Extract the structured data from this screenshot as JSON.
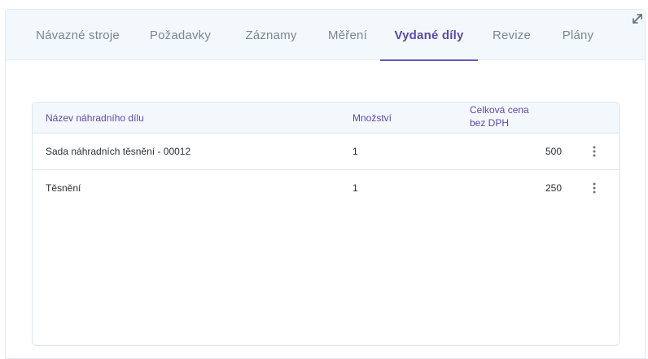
{
  "tabs": [
    {
      "label": "Návazné stroje",
      "active": false
    },
    {
      "label": "Požadavky",
      "active": false
    },
    {
      "label": "Záznamy",
      "active": false
    },
    {
      "label": "Měření",
      "active": false
    },
    {
      "label": "Vydané díly",
      "active": true
    },
    {
      "label": "Revize",
      "active": false
    },
    {
      "label": "Plány",
      "active": false
    }
  ],
  "expand_icon": "expand-arrows-icon",
  "table": {
    "columns": {
      "name": "Název náhradního dílu",
      "quantity": "Množství",
      "price_line1": "Celková cena",
      "price_line2": "bez DPH"
    },
    "rows": [
      {
        "name": "Sada náhradních těsnění - 00012",
        "quantity": "1",
        "price": "500"
      },
      {
        "name": "Těsnění",
        "quantity": "1",
        "price": "250"
      }
    ],
    "row_menu_icon": "more-vertical-icon"
  },
  "colors": {
    "accent": "#5d49a8",
    "tab_bg": "#f3f8fd",
    "muted_text": "#7c8791"
  }
}
